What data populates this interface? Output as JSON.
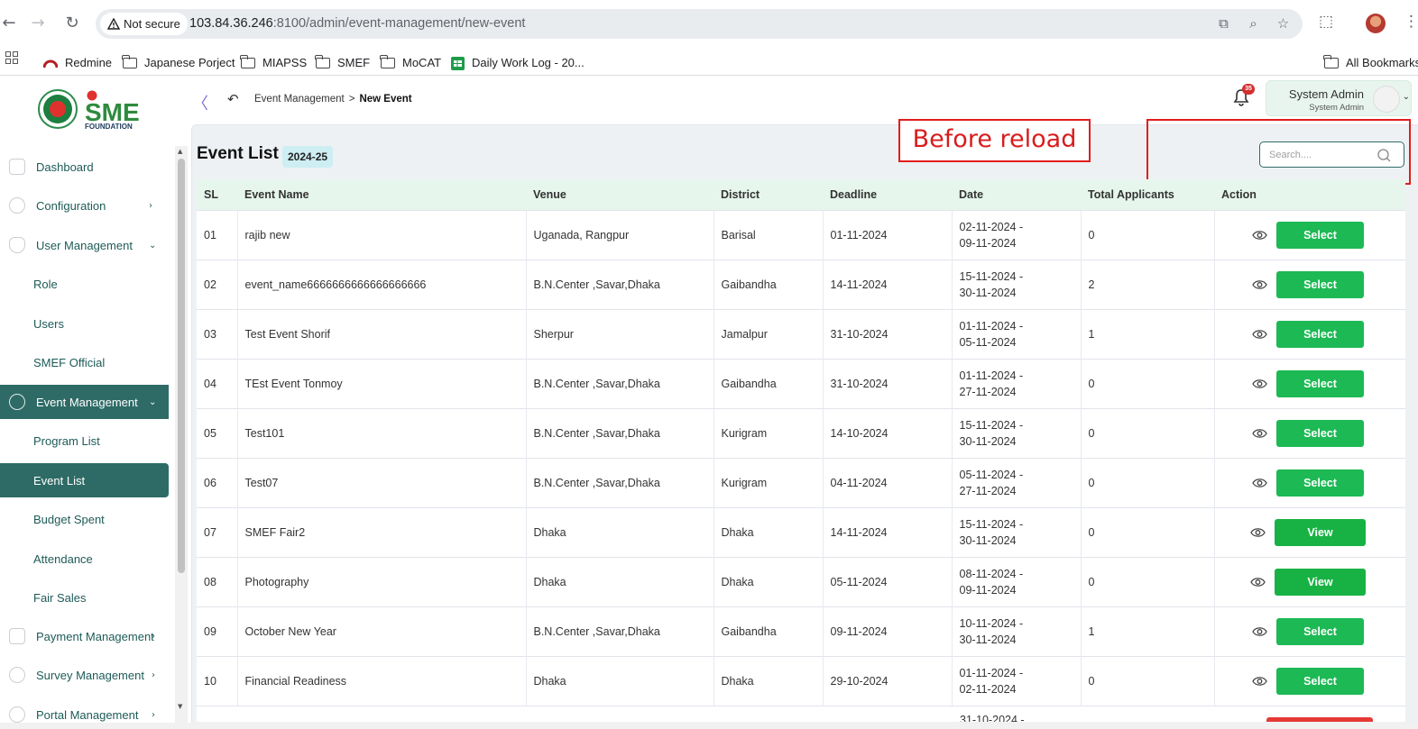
{
  "browser": {
    "security_label": "Not secure",
    "url_host": "103.84.36.246",
    "url_rest": ":8100/admin/event-management/new-event",
    "bookmarks": [
      "Redmine",
      "Japanese Porject",
      "MIAPSS",
      "SMEF",
      "MoCAT",
      "Daily Work Log - 20..."
    ],
    "all_bookmarks": "All Bookmarks"
  },
  "header": {
    "logo_text": "SME",
    "logo_sub": "FOUNDATION",
    "breadcrumb_parent": "Event Management",
    "breadcrumb_sep": ">",
    "breadcrumb_current": "New Event",
    "notification_count": "35",
    "user_name": "System Admin",
    "user_role": "System Admin"
  },
  "sidebar": {
    "items": [
      {
        "label": "Dashboard"
      },
      {
        "label": "Configuration",
        "chevron": "›"
      },
      {
        "label": "User Management",
        "chevron": "⌄"
      },
      {
        "label": "Role"
      },
      {
        "label": "Users"
      },
      {
        "label": "SMEF Official"
      },
      {
        "label": "Event Management",
        "chevron": "⌄"
      },
      {
        "label": "Program List"
      },
      {
        "label": "Event List"
      },
      {
        "label": "Budget Spent"
      },
      {
        "label": "Attendance"
      },
      {
        "label": "Fair Sales"
      },
      {
        "label": "Payment Management",
        "chevron": "›"
      },
      {
        "label": "Survey Management",
        "chevron": "›"
      },
      {
        "label": "Portal Management",
        "chevron": "›"
      }
    ]
  },
  "main": {
    "title": "Event List",
    "year": "2024-25",
    "search_placeholder": "Search....",
    "annotation": "Before reload"
  },
  "table": {
    "headers": [
      "SL",
      "Event Name",
      "Venue",
      "District",
      "Deadline",
      "Date",
      "Total Applicants",
      "Action"
    ],
    "rows": [
      {
        "sl": "01",
        "name": "rajib new",
        "venue": "Uganada, Rangpur",
        "district": "Barisal",
        "deadline": "01-11-2024",
        "date1": "02-11-2024 -",
        "date2": "09-11-2024",
        "total": "0",
        "action": "Select"
      },
      {
        "sl": "02",
        "name": "event_name6666666666666666666",
        "venue": "B.N.Center ,Savar,Dhaka",
        "district": "Gaibandha",
        "deadline": "14-11-2024",
        "date1": "15-11-2024 -",
        "date2": "30-11-2024",
        "total": "2",
        "action": "Select"
      },
      {
        "sl": "03",
        "name": "Test Event Shorif",
        "venue": "Sherpur",
        "district": "Jamalpur",
        "deadline": "31-10-2024",
        "date1": "01-11-2024 -",
        "date2": "05-11-2024",
        "total": "1",
        "action": "Select"
      },
      {
        "sl": "04",
        "name": "TEst Event Tonmoy",
        "venue": "B.N.Center ,Savar,Dhaka",
        "district": "Gaibandha",
        "deadline": "31-10-2024",
        "date1": "01-11-2024 -",
        "date2": "27-11-2024",
        "total": "0",
        "action": "Select"
      },
      {
        "sl": "05",
        "name": "Test101",
        "venue": "B.N.Center ,Savar,Dhaka",
        "district": "Kurigram",
        "deadline": "14-10-2024",
        "date1": "15-11-2024 -",
        "date2": "30-11-2024",
        "total": "0",
        "action": "Select"
      },
      {
        "sl": "06",
        "name": "Test07",
        "venue": "B.N.Center ,Savar,Dhaka",
        "district": "Kurigram",
        "deadline": "04-11-2024",
        "date1": "05-11-2024 -",
        "date2": "27-11-2024",
        "total": "0",
        "action": "Select"
      },
      {
        "sl": "07",
        "name": "SMEF Fair2",
        "venue": "Dhaka",
        "district": "Dhaka",
        "deadline": "14-11-2024",
        "date1": "15-11-2024 -",
        "date2": "30-11-2024",
        "total": "0",
        "action": "View"
      },
      {
        "sl": "08",
        "name": "Photography",
        "venue": "Dhaka",
        "district": "Dhaka",
        "deadline": "05-11-2024",
        "date1": "08-11-2024 -",
        "date2": "09-11-2024",
        "total": "0",
        "action": "View"
      },
      {
        "sl": "09",
        "name": "October New Year",
        "venue": "B.N.Center ,Savar,Dhaka",
        "district": "Gaibandha",
        "deadline": "09-11-2024",
        "date1": "10-11-2024 -",
        "date2": "30-11-2024",
        "total": "1",
        "action": "Select"
      },
      {
        "sl": "10",
        "name": "Financial Readiness",
        "venue": "Dhaka",
        "district": "Dhaka",
        "deadline": "29-10-2024",
        "date1": "01-11-2024 -",
        "date2": "02-11-2024",
        "total": "0",
        "action": "Select"
      }
    ],
    "partial_row_date": "31-10-2024 -"
  },
  "colors": {
    "accent": "#2e6b66",
    "select_button": "#1db954",
    "annotation": "#e21d1d",
    "header_row": "#e6f6ec"
  }
}
